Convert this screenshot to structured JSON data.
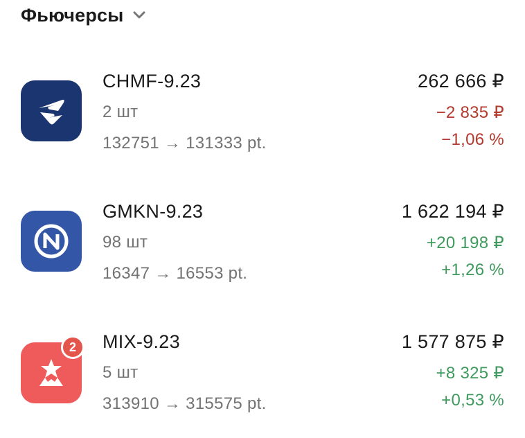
{
  "header": {
    "title": "Фьючерсы",
    "chevron_icon": "chevron-down-icon"
  },
  "colors": {
    "negative": "#b33a2f",
    "positive": "#3f9a5e",
    "chmf_logo_bg": "#1a3570",
    "gmkn_logo_bg": "#3356a6",
    "mix_logo_bg": "#ef5b5b",
    "badge_bg": "#e4554c"
  },
  "positions": [
    {
      "name": "CHMF-9.23",
      "qty": "2 шт",
      "range": "132751 → 131333 pt.",
      "value": "262 666 ₽",
      "change": "−2 835 ₽",
      "pct": "−1,06 %",
      "trend": "negative",
      "logo_icon": "severstal-logo-icon"
    },
    {
      "name": "GMKN-9.23",
      "qty": "98 шт",
      "range": "16347 → 16553 pt.",
      "value": "1 622 194 ₽",
      "change": "+20 198 ₽",
      "pct": "+1,26 %",
      "trend": "positive",
      "logo_icon": "nornickel-logo-icon"
    },
    {
      "name": "MIX-9.23",
      "qty": "5 шт",
      "range": "313910 → 315575 pt.",
      "value": "1 577 875 ₽",
      "change": "+8 325 ₽",
      "pct": "+0,53 %",
      "trend": "positive",
      "logo_icon": "moex-index-logo-icon",
      "badge": "2"
    }
  ]
}
